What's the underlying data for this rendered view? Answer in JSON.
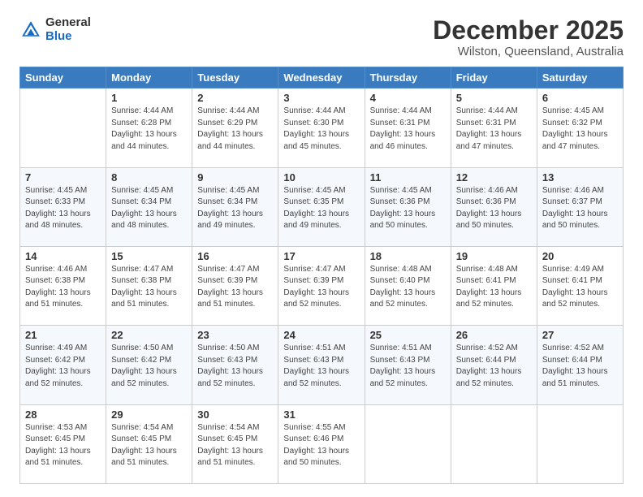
{
  "header": {
    "logo_general": "General",
    "logo_blue": "Blue",
    "main_title": "December 2025",
    "subtitle": "Wilston, Queensland, Australia"
  },
  "weekdays": [
    "Sunday",
    "Monday",
    "Tuesday",
    "Wednesday",
    "Thursday",
    "Friday",
    "Saturday"
  ],
  "weeks": [
    [
      {
        "day": "",
        "info": ""
      },
      {
        "day": "1",
        "info": "Sunrise: 4:44 AM\nSunset: 6:28 PM\nDaylight: 13 hours\nand 44 minutes."
      },
      {
        "day": "2",
        "info": "Sunrise: 4:44 AM\nSunset: 6:29 PM\nDaylight: 13 hours\nand 44 minutes."
      },
      {
        "day": "3",
        "info": "Sunrise: 4:44 AM\nSunset: 6:30 PM\nDaylight: 13 hours\nand 45 minutes."
      },
      {
        "day": "4",
        "info": "Sunrise: 4:44 AM\nSunset: 6:31 PM\nDaylight: 13 hours\nand 46 minutes."
      },
      {
        "day": "5",
        "info": "Sunrise: 4:44 AM\nSunset: 6:31 PM\nDaylight: 13 hours\nand 47 minutes."
      },
      {
        "day": "6",
        "info": "Sunrise: 4:45 AM\nSunset: 6:32 PM\nDaylight: 13 hours\nand 47 minutes."
      }
    ],
    [
      {
        "day": "7",
        "info": "Sunrise: 4:45 AM\nSunset: 6:33 PM\nDaylight: 13 hours\nand 48 minutes."
      },
      {
        "day": "8",
        "info": "Sunrise: 4:45 AM\nSunset: 6:34 PM\nDaylight: 13 hours\nand 48 minutes."
      },
      {
        "day": "9",
        "info": "Sunrise: 4:45 AM\nSunset: 6:34 PM\nDaylight: 13 hours\nand 49 minutes."
      },
      {
        "day": "10",
        "info": "Sunrise: 4:45 AM\nSunset: 6:35 PM\nDaylight: 13 hours\nand 49 minutes."
      },
      {
        "day": "11",
        "info": "Sunrise: 4:45 AM\nSunset: 6:36 PM\nDaylight: 13 hours\nand 50 minutes."
      },
      {
        "day": "12",
        "info": "Sunrise: 4:46 AM\nSunset: 6:36 PM\nDaylight: 13 hours\nand 50 minutes."
      },
      {
        "day": "13",
        "info": "Sunrise: 4:46 AM\nSunset: 6:37 PM\nDaylight: 13 hours\nand 50 minutes."
      }
    ],
    [
      {
        "day": "14",
        "info": "Sunrise: 4:46 AM\nSunset: 6:38 PM\nDaylight: 13 hours\nand 51 minutes."
      },
      {
        "day": "15",
        "info": "Sunrise: 4:47 AM\nSunset: 6:38 PM\nDaylight: 13 hours\nand 51 minutes."
      },
      {
        "day": "16",
        "info": "Sunrise: 4:47 AM\nSunset: 6:39 PM\nDaylight: 13 hours\nand 51 minutes."
      },
      {
        "day": "17",
        "info": "Sunrise: 4:47 AM\nSunset: 6:39 PM\nDaylight: 13 hours\nand 52 minutes."
      },
      {
        "day": "18",
        "info": "Sunrise: 4:48 AM\nSunset: 6:40 PM\nDaylight: 13 hours\nand 52 minutes."
      },
      {
        "day": "19",
        "info": "Sunrise: 4:48 AM\nSunset: 6:41 PM\nDaylight: 13 hours\nand 52 minutes."
      },
      {
        "day": "20",
        "info": "Sunrise: 4:49 AM\nSunset: 6:41 PM\nDaylight: 13 hours\nand 52 minutes."
      }
    ],
    [
      {
        "day": "21",
        "info": "Sunrise: 4:49 AM\nSunset: 6:42 PM\nDaylight: 13 hours\nand 52 minutes."
      },
      {
        "day": "22",
        "info": "Sunrise: 4:50 AM\nSunset: 6:42 PM\nDaylight: 13 hours\nand 52 minutes."
      },
      {
        "day": "23",
        "info": "Sunrise: 4:50 AM\nSunset: 6:43 PM\nDaylight: 13 hours\nand 52 minutes."
      },
      {
        "day": "24",
        "info": "Sunrise: 4:51 AM\nSunset: 6:43 PM\nDaylight: 13 hours\nand 52 minutes."
      },
      {
        "day": "25",
        "info": "Sunrise: 4:51 AM\nSunset: 6:43 PM\nDaylight: 13 hours\nand 52 minutes."
      },
      {
        "day": "26",
        "info": "Sunrise: 4:52 AM\nSunset: 6:44 PM\nDaylight: 13 hours\nand 52 minutes."
      },
      {
        "day": "27",
        "info": "Sunrise: 4:52 AM\nSunset: 6:44 PM\nDaylight: 13 hours\nand 51 minutes."
      }
    ],
    [
      {
        "day": "28",
        "info": "Sunrise: 4:53 AM\nSunset: 6:45 PM\nDaylight: 13 hours\nand 51 minutes."
      },
      {
        "day": "29",
        "info": "Sunrise: 4:54 AM\nSunset: 6:45 PM\nDaylight: 13 hours\nand 51 minutes."
      },
      {
        "day": "30",
        "info": "Sunrise: 4:54 AM\nSunset: 6:45 PM\nDaylight: 13 hours\nand 51 minutes."
      },
      {
        "day": "31",
        "info": "Sunrise: 4:55 AM\nSunset: 6:46 PM\nDaylight: 13 hours\nand 50 minutes."
      },
      {
        "day": "",
        "info": ""
      },
      {
        "day": "",
        "info": ""
      },
      {
        "day": "",
        "info": ""
      }
    ]
  ]
}
